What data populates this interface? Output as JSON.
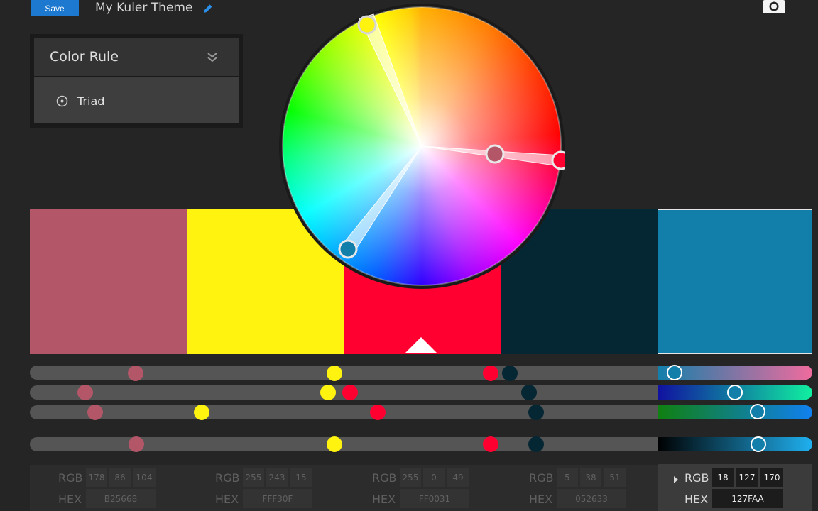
{
  "toolbar": {
    "save_label": "Save",
    "theme_name": "My Kuler Theme",
    "edit_icon": "pencil-icon",
    "camera_icon": "camera-icon"
  },
  "color_rule": {
    "title": "Color Rule",
    "collapse_icon": "double-chevron-down-icon",
    "selected_option": "Triad",
    "option_icon": "radio-icon"
  },
  "swatches": [
    {
      "hex": "#B25668",
      "selected": false
    },
    {
      "hex": "#FFF30F",
      "selected": false
    },
    {
      "hex": "#FF0031",
      "selected": false,
      "base": true
    },
    {
      "hex": "#052633",
      "selected": false
    },
    {
      "hex": "#127FAA",
      "selected": true
    }
  ],
  "colors": [
    {
      "rgb_label": "RGB",
      "r": "178",
      "g": "86",
      "b": "104",
      "hex_label": "HEX",
      "hex": "B25668"
    },
    {
      "rgb_label": "RGB",
      "r": "255",
      "g": "243",
      "b": "15",
      "hex_label": "HEX",
      "hex": "FFF30F"
    },
    {
      "rgb_label": "RGB",
      "r": "255",
      "g": "0",
      "b": "49",
      "hex_label": "HEX",
      "hex": "FF0031"
    },
    {
      "rgb_label": "RGB",
      "r": "5",
      "g": "38",
      "b": "51",
      "hex_label": "HEX",
      "hex": "052633"
    },
    {
      "rgb_label": "RGB",
      "r": "18",
      "g": "127",
      "b": "170",
      "hex_label": "HEX",
      "hex": "127FAA"
    }
  ],
  "active_color_index": 4
}
